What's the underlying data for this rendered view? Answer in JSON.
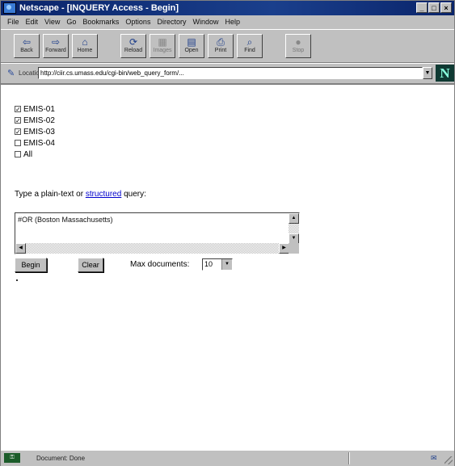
{
  "window": {
    "title": "Netscape - [INQUERY Access - Begin]",
    "controls": [
      "_",
      "□",
      "×"
    ]
  },
  "menu": [
    "File",
    "Edit",
    "View",
    "Go",
    "Bookmarks",
    "Options",
    "Directory",
    "Window",
    "Help"
  ],
  "toolbar": {
    "buttons": [
      {
        "label": "Back",
        "icon": "back-arrow-icon",
        "glyph": "⇦"
      },
      {
        "label": "Forward",
        "icon": "forward-arrow-icon",
        "glyph": "⇨"
      },
      {
        "label": "Home",
        "icon": "home-icon",
        "glyph": "⌂"
      },
      {
        "label": "Reload",
        "icon": "reload-icon",
        "glyph": "⟳"
      },
      {
        "label": "Images",
        "icon": "images-icon",
        "glyph": "▦"
      },
      {
        "label": "Open",
        "icon": "open-icon",
        "glyph": "▤"
      },
      {
        "label": "Print",
        "icon": "print-icon",
        "glyph": "⎙"
      },
      {
        "label": "Find",
        "icon": "find-icon",
        "glyph": "⌕"
      },
      {
        "label": "Stop",
        "icon": "stop-icon",
        "glyph": "●"
      }
    ]
  },
  "location": {
    "label": "Location:",
    "url": "http://ciir.cs.umass.edu/cgi-bin/web_query_form/...",
    "logo": "N"
  },
  "databases": [
    {
      "label": "EMIS-01",
      "checked": true
    },
    {
      "label": "EMIS-02",
      "checked": true
    },
    {
      "label": "EMIS-03",
      "checked": true
    },
    {
      "label": "EMIS-04",
      "checked": false
    },
    {
      "label": "All",
      "checked": false
    }
  ],
  "query": {
    "prompt_before": "Type a plain-text or",
    "link": "structured",
    "prompt_after": "query:",
    "value": "#OR (Boston Massachusetts)"
  },
  "actions": {
    "begin": "Begin",
    "clear": "Clear",
    "max_label": "Max documents:",
    "max_value": "10"
  },
  "statusbar": {
    "text": "Document: Done"
  }
}
